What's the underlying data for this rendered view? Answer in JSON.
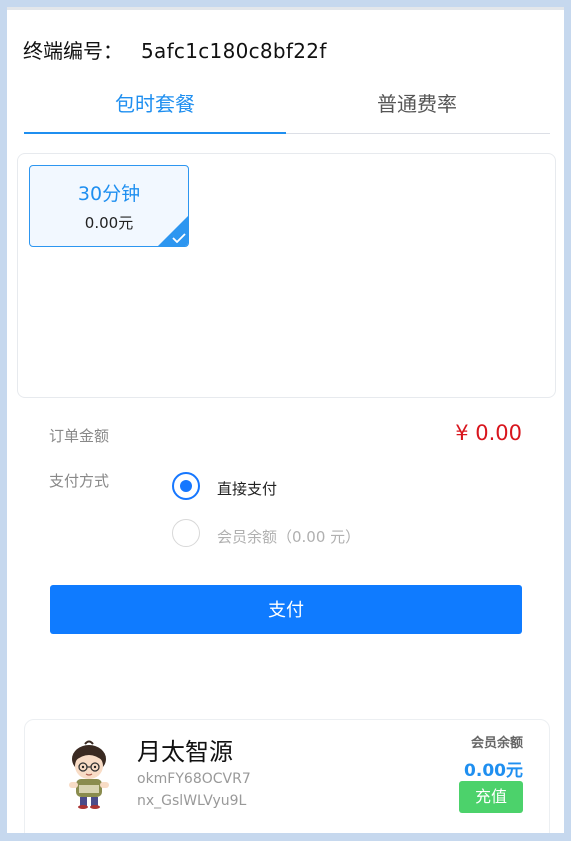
{
  "terminal": {
    "label": "终端编号：",
    "id": "5afc1c180c8bf22f"
  },
  "tabs": [
    {
      "label": "包时套餐",
      "active": true
    },
    {
      "label": "普通费率",
      "active": false
    }
  ],
  "packages": [
    {
      "name": "30分钟",
      "price": "0.00元",
      "selected": true
    }
  ],
  "order": {
    "label": "订单金额",
    "amount": "¥ 0.00"
  },
  "payment": {
    "label": "支付方式",
    "options": [
      {
        "label": "直接支付",
        "checked": true,
        "disabled": false
      },
      {
        "label": "会员余额（0.00 元）",
        "checked": false,
        "disabled": true
      }
    ]
  },
  "pay_button": "支付",
  "member": {
    "nickname": "月太智源",
    "openid_line1": "okmFY68OCVR7",
    "openid_line2": "nx_GslWLVyu9L",
    "balance_label": "会员余额",
    "balance_value": "0.00元",
    "recharge_label": "充值"
  },
  "colors": {
    "accent": "#1f8ff0",
    "pay_button": "#0f7bff",
    "amount": "#d8151d",
    "recharge": "#4cd26b"
  }
}
